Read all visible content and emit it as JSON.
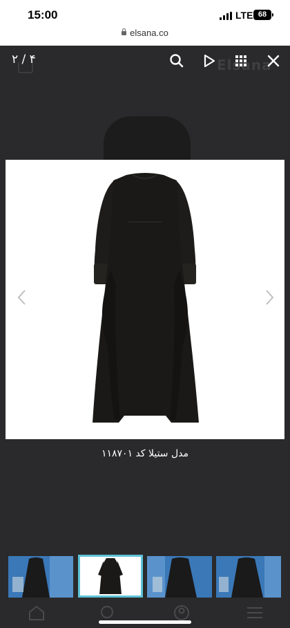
{
  "status_bar": {
    "time": "15:00",
    "network": "LTE",
    "battery": "68"
  },
  "browser": {
    "url": "elsana.co"
  },
  "lightbox": {
    "counter": "۲ / ۴",
    "caption": "مدل ستیلا کد ۱۱۸۷۰۱",
    "icons": [
      "search-icon",
      "play-icon",
      "grid-icon",
      "close-icon"
    ]
  },
  "ghost": {
    "logo": "Elsana"
  },
  "thumbnails": {
    "count": 4,
    "active_index": 1
  },
  "colors": {
    "overlay_bg": "#2a2a2c",
    "active_thumb_border": "#5ec2d6",
    "thumb_bg": "#3f7fc0"
  }
}
